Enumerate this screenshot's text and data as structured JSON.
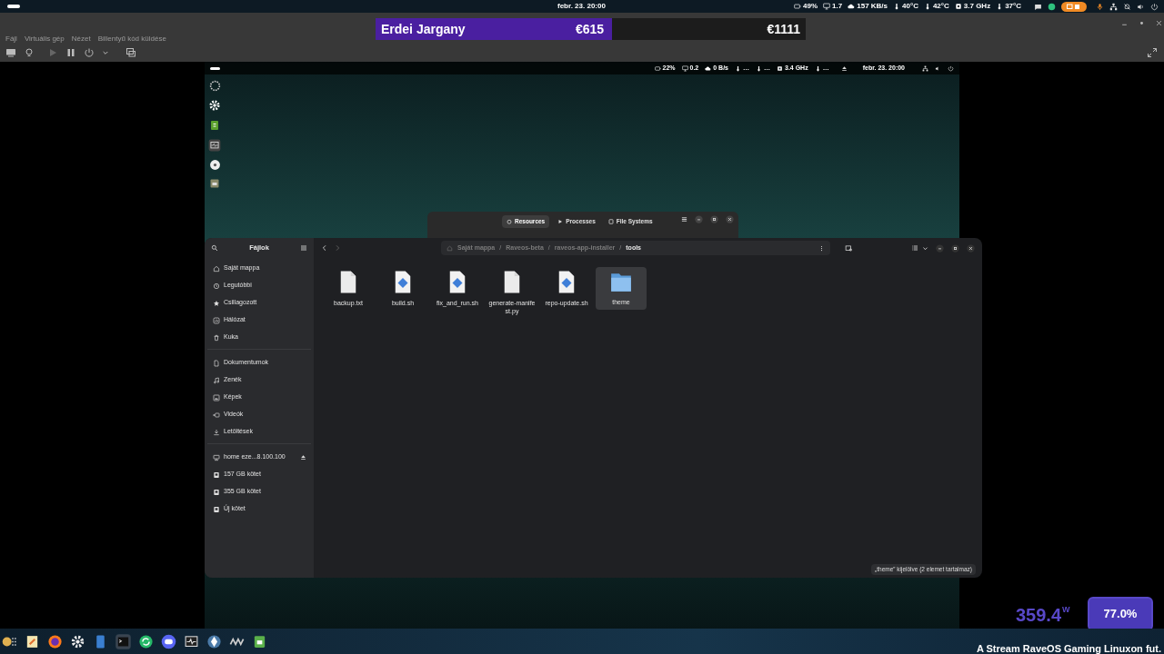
{
  "host_bar": {
    "date": "febr. 23. 20:00",
    "indicators": [
      "49%",
      "1.7",
      "157 KB/s",
      "40°C",
      "42°C",
      "3.7 GHz",
      "37°C"
    ]
  },
  "vm_window": {
    "menu": [
      "Fájl",
      "Virtuális gép",
      "Nézet",
      "Billentyű kód küldése"
    ]
  },
  "donation_banner": {
    "name": "Erdei Jargany",
    "amount": "€615",
    "goal": "€1111",
    "level": 0.55
  },
  "guest": {
    "top_bar": {
      "date": "febr. 23. 20:00",
      "indicators": [
        "22%",
        "0.2",
        "0 B/s",
        "…",
        "…",
        "3.4 GHz",
        "…"
      ]
    },
    "system_monitor": {
      "tabs": [
        {
          "label": "Resources",
          "selected": true
        },
        {
          "label": "Processes",
          "selected": false
        },
        {
          "label": "File Systems",
          "selected": false
        }
      ]
    },
    "file_manager": {
      "title": "Fájlok",
      "sidebar": [
        [
          {
            "label": "Saját mappa",
            "eject": false
          },
          {
            "label": "Legutóbbi",
            "eject": false
          },
          {
            "label": "Csillagozott",
            "eject": false
          },
          {
            "label": "Hálózat",
            "eject": false
          },
          {
            "label": "Kuka",
            "eject": false
          }
        ],
        [
          {
            "label": "Dokumentumok",
            "eject": false
          },
          {
            "label": "Zenék",
            "eject": false
          },
          {
            "label": "Képek",
            "eject": false
          },
          {
            "label": "Videók",
            "eject": false
          },
          {
            "label": "Letöltések",
            "eject": false
          }
        ],
        [
          {
            "label": "home eze...8.100.100",
            "eject": true
          },
          {
            "label": "157 GB kötet",
            "eject": false
          },
          {
            "label": "355 GB kötet",
            "eject": false
          },
          {
            "label": "Új kötet",
            "eject": false
          }
        ]
      ],
      "path": [
        "Saját mappa",
        "Raveos-beta",
        "raveos-app-installer",
        "tools"
      ],
      "path_separator": "/",
      "files": [
        {
          "kind": "text",
          "name": "backup.txt",
          "selected": false
        },
        {
          "kind": "script",
          "name": "build.sh",
          "selected": false
        },
        {
          "kind": "script",
          "name": "fix_and_run.sh",
          "selected": false
        },
        {
          "kind": "text",
          "name": "generate-manifest.py",
          "selected": false
        },
        {
          "kind": "script",
          "name": "repo-update.sh",
          "selected": false
        },
        {
          "kind": "folder",
          "name": "theme",
          "selected": true
        }
      ],
      "status": "„theme” kijelölve (2 elemet tartalmaz)"
    }
  },
  "power_overlay": {
    "watts": "359.4",
    "unit": "W",
    "percent": "77.0%"
  },
  "taskbar": {
    "ticker": "A Stream RaveOS Gaming Linuxon fut."
  }
}
